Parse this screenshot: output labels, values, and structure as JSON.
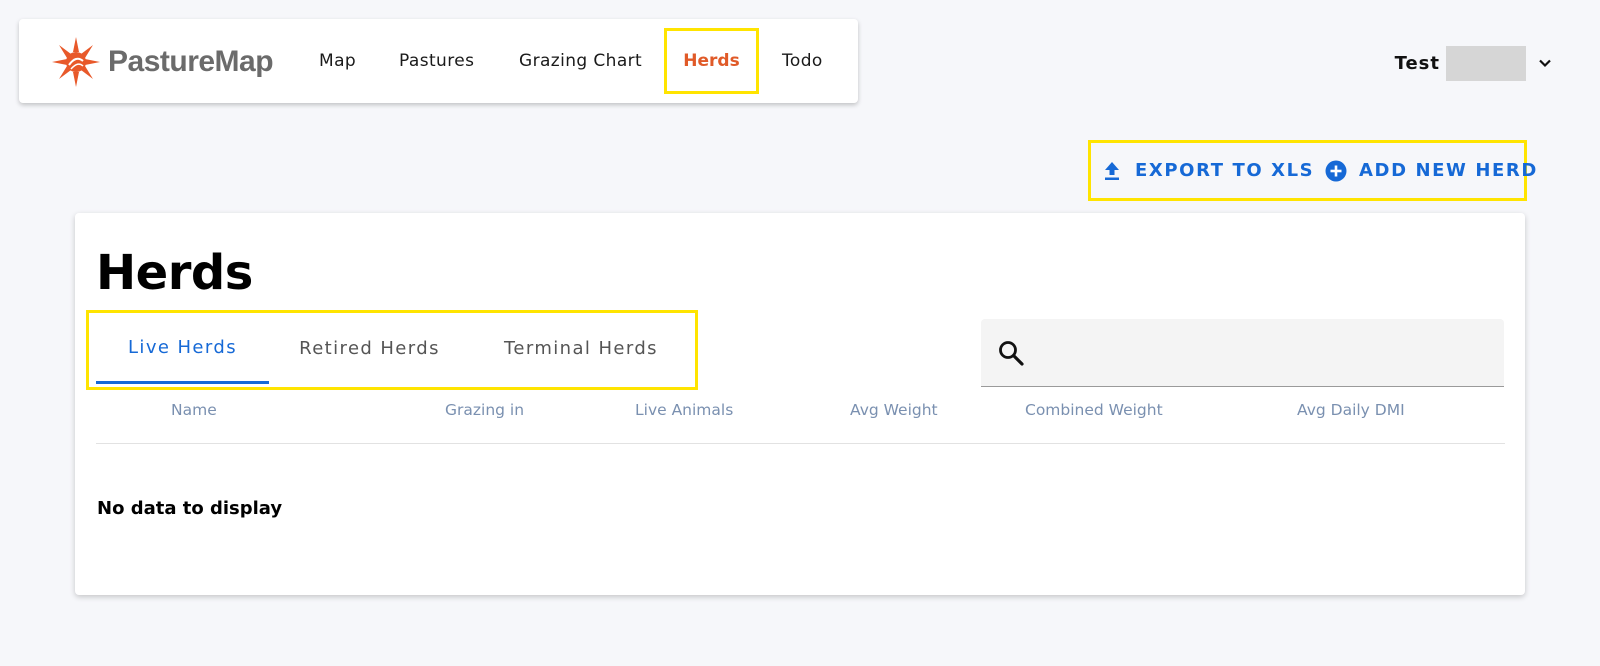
{
  "nav": {
    "logo_text": "PastureMap",
    "items": [
      "Map",
      "Pastures",
      "Grazing Chart",
      "Herds",
      "Todo"
    ],
    "active": "Herds",
    "active_color": "#e05a28"
  },
  "user": {
    "name": "Test",
    "menu_icon": "chevron-down-icon"
  },
  "actions": {
    "export_label": "EXPORT TO XLS",
    "export_icon": "upload-icon",
    "add_label": "ADD NEW HERD",
    "add_icon": "add-circle-icon",
    "color": "#1669d6"
  },
  "page": {
    "title": "Herds"
  },
  "tabs": {
    "items": [
      "Live Herds",
      "Retired Herds",
      "Terminal Herds"
    ],
    "active": "Live Herds"
  },
  "search": {
    "icon": "search-icon",
    "value": "",
    "placeholder": ""
  },
  "table": {
    "columns": [
      "Name",
      "Grazing in",
      "Live Animals",
      "Avg Weight",
      "Combined Weight",
      "Avg Daily DMI"
    ],
    "rows": [],
    "empty_message": "No data to display"
  },
  "highlight_color": "#ffe400"
}
